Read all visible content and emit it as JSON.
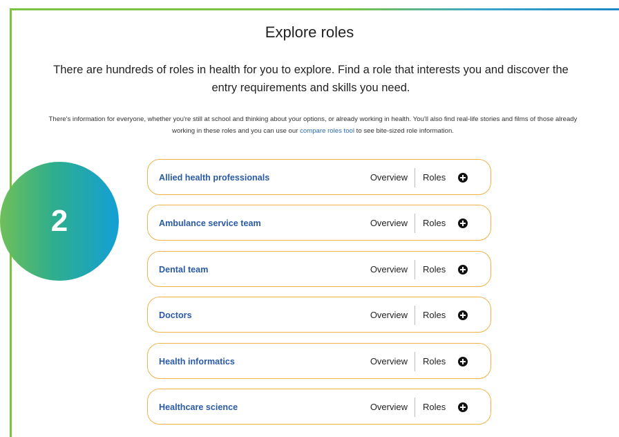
{
  "header": {
    "title": "Explore roles"
  },
  "intro": {
    "text": "There are hundreds of roles in health for you to explore. Find a role that interests you and discover the entry requirements and skills you need."
  },
  "info": {
    "before_link": "There's information for everyone, whether you're still at school and thinking about your options, or already working in health. You'll also find real-life stories and films of those already working in these roles and you can use our ",
    "link_text": "compare roles tool",
    "after_link": " to see bite-sized role information."
  },
  "badge": {
    "number": "2"
  },
  "roles": {
    "overview_label": "Overview",
    "roles_label": "Roles",
    "items": [
      {
        "label": "Allied health professionals"
      },
      {
        "label": "Ambulance service team"
      },
      {
        "label": "Dental team"
      },
      {
        "label": "Doctors"
      },
      {
        "label": "Health informatics"
      },
      {
        "label": "Healthcare science"
      }
    ]
  },
  "colors": {
    "accent_green": "#7dc242",
    "accent_blue": "#139fd6",
    "row_border": "#f0b24a",
    "link_blue": "#2a5aa6"
  }
}
